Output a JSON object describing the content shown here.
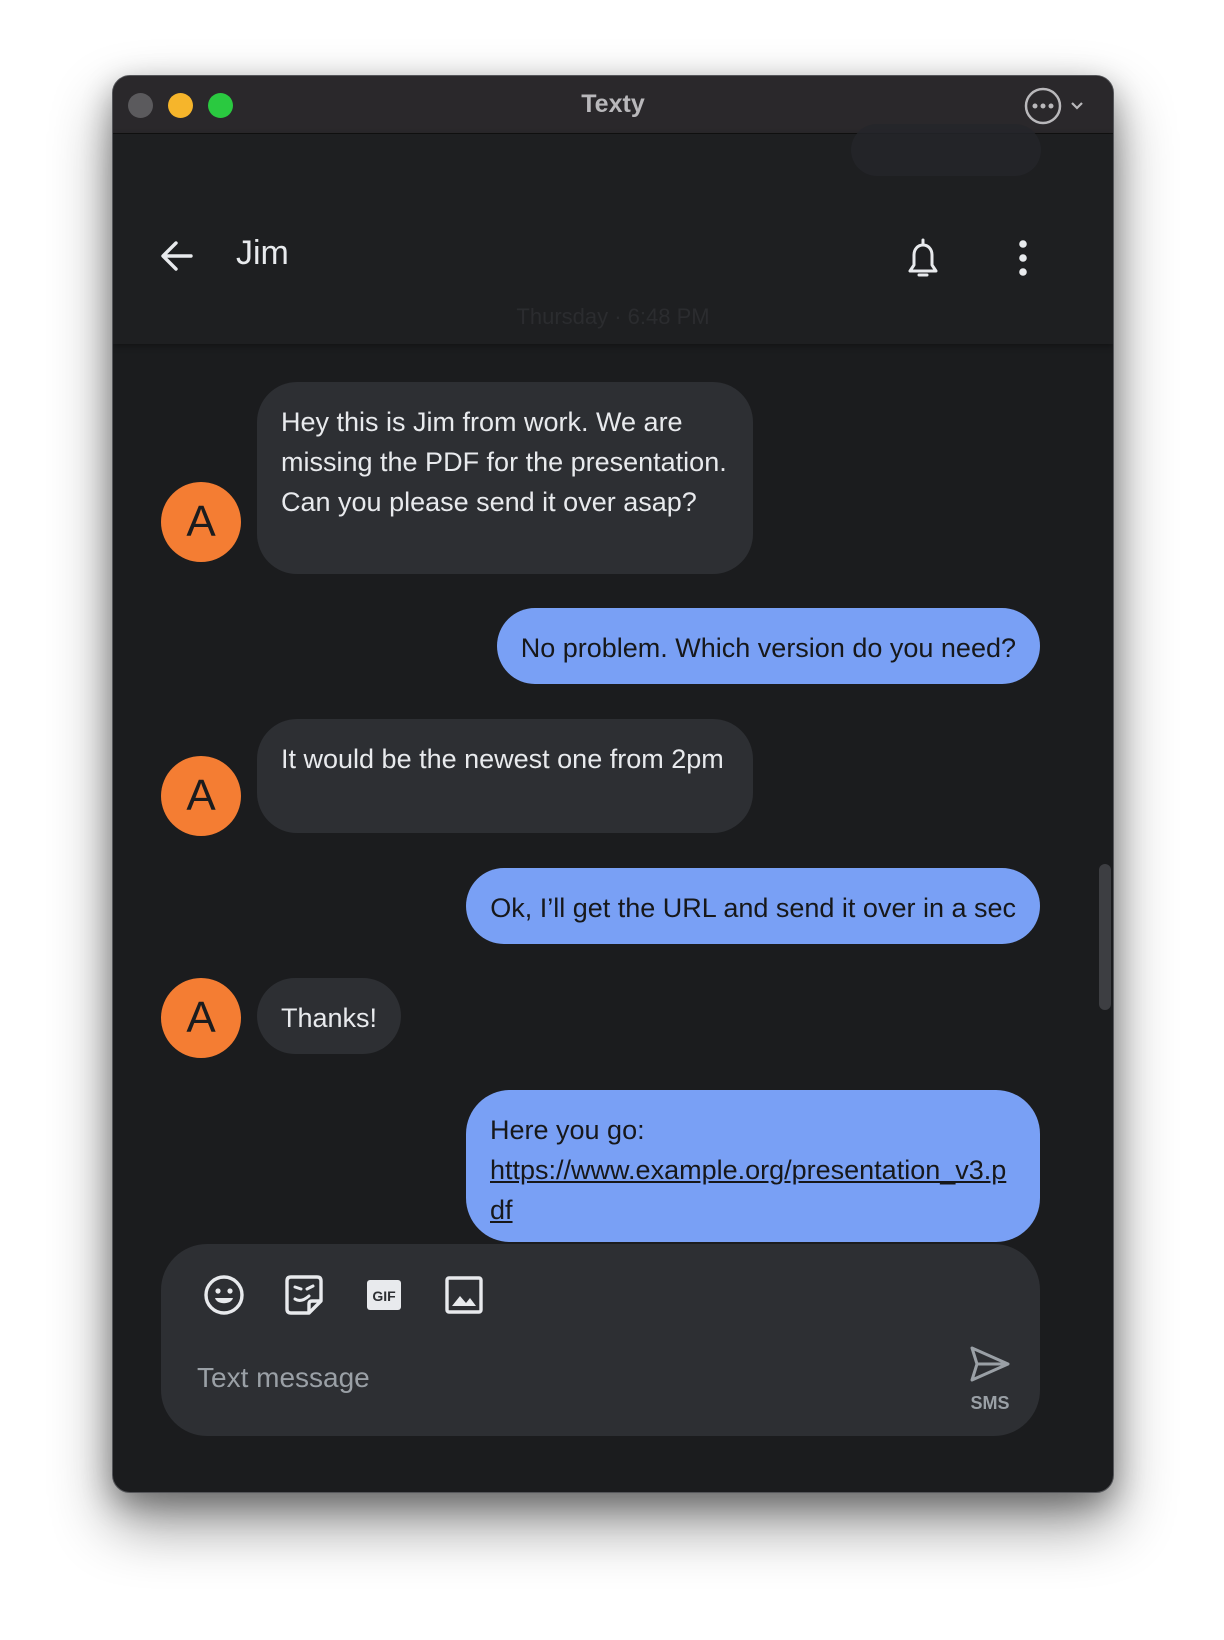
{
  "window": {
    "title": "Texty"
  },
  "header": {
    "contact_name": "Jim",
    "ghost_timestamp": "Thursday · 6:48 PM"
  },
  "messages": [
    {
      "direction": "incoming",
      "avatar_letter": "A",
      "text": "Hey this is Jim from work. We are missing the PDF for the presentation. Can you please send it over asap?"
    },
    {
      "direction": "outgoing",
      "text": "No problem. Which version do you need?"
    },
    {
      "direction": "incoming",
      "avatar_letter": "A",
      "text": "It would be the newest one from 2pm"
    },
    {
      "direction": "outgoing",
      "text": "Ok, I’ll get the URL and send it over in a sec"
    },
    {
      "direction": "incoming",
      "avatar_letter": "A",
      "text": "Thanks!"
    },
    {
      "direction": "outgoing",
      "text": "Here you go:",
      "link": "https://www.example.org/presentation_v3.pdf"
    }
  ],
  "composer": {
    "placeholder": "Text message",
    "send_label": "SMS",
    "icons": [
      "emoji-icon",
      "sticker-icon",
      "gif-icon",
      "image-icon"
    ]
  },
  "colors": {
    "background": "#1b1c1e",
    "incoming_bubble": "#2d2f33",
    "outgoing_bubble": "#79a0f5",
    "avatar": "#f47d33"
  }
}
